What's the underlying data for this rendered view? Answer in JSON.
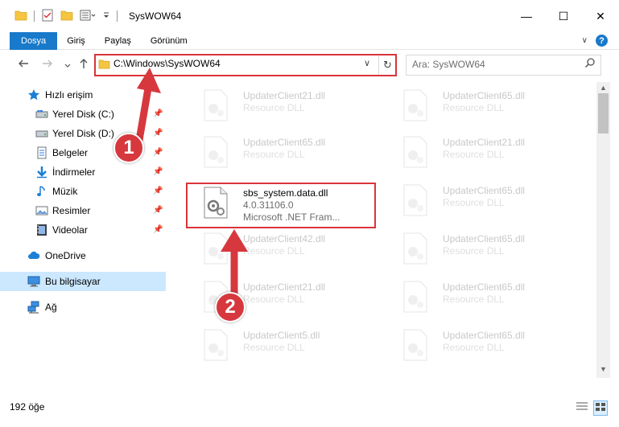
{
  "window": {
    "title": "SysWOW64",
    "minimize_glyph": "—",
    "maximize_glyph": "☐",
    "close_glyph": "✕"
  },
  "ribbon": {
    "tabs": [
      "Dosya",
      "Giriş",
      "Paylaş",
      "Görünüm"
    ],
    "expand_glyph": "∨",
    "help_glyph": "?"
  },
  "address": {
    "path": "C:\\Windows\\SysWOW64",
    "dropdown_glyph": "∨",
    "refresh_glyph": "↻"
  },
  "search": {
    "placeholder": "Ara: SysWOW64"
  },
  "sidebar": {
    "quick_access": "Hızlı erişim",
    "items": [
      {
        "label": "Yerel Disk (C:)",
        "icon": "drive-icon"
      },
      {
        "label": "Yerel Disk (D:)",
        "icon": "drive-icon"
      },
      {
        "label": "Belgeler",
        "icon": "documents-icon"
      },
      {
        "label": "İndirmeler",
        "icon": "download-icon"
      },
      {
        "label": "Müzik",
        "icon": "music-icon"
      },
      {
        "label": "Resimler",
        "icon": "pictures-icon"
      },
      {
        "label": "Videolar",
        "icon": "videos-icon"
      }
    ],
    "onedrive": "OneDrive",
    "this_pc": "Bu bilgisayar",
    "network": "Ağ"
  },
  "files": {
    "left_column": [
      {
        "name": "UpdaterClient21.dll",
        "type": "Resource DLL"
      },
      {
        "name": "UpdaterClient65.dll",
        "type": "Resource DLL"
      },
      {
        "name": "sbs_system.data.dll",
        "version": "4.0.31106.0",
        "company": "Microsoft .NET Fram..."
      },
      {
        "name": "UpdaterClient42.dll",
        "type": "Resource DLL"
      },
      {
        "name": "UpdaterClient21.dll",
        "type": "Resource DLL"
      },
      {
        "name": "UpdaterClient5.dll",
        "type": "Resource DLL"
      }
    ],
    "right_column": [
      {
        "name": "UpdaterClient65.dll",
        "type": "Resource DLL"
      },
      {
        "name": "UpdaterClient21.dll",
        "type": "Resource DLL"
      },
      {
        "name": "UpdaterClient65.dll",
        "type": "Resource DLL"
      },
      {
        "name": "UpdaterClient65.dll",
        "type": "Resource DLL"
      },
      {
        "name": "UpdaterClient65.dll",
        "type": "Resource DLL"
      },
      {
        "name": "UpdaterClient65.dll",
        "type": "Resource DLL"
      }
    ]
  },
  "status": {
    "item_count": "192 öğe"
  },
  "annotations": {
    "step1": "1",
    "step2": "2",
    "color": "#d6383e"
  },
  "colors": {
    "accent": "#1979ca",
    "selected_bg": "#cce8ff",
    "highlight_border": "#d9343a"
  }
}
